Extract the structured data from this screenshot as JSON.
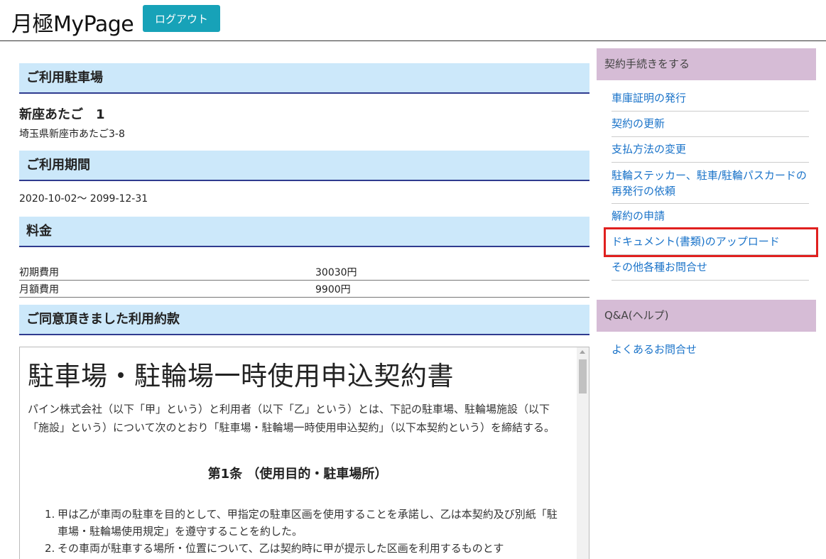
{
  "header": {
    "app_title": "月極MyPage",
    "logout_label": "ログアウト"
  },
  "main": {
    "parking": {
      "heading": "ご利用駐車場",
      "name": "新座あたご　1",
      "address": "埼玉県新座市あたご3-8"
    },
    "period": {
      "heading": "ご利用期間",
      "value": "2020-10-02〜 2099-12-31"
    },
    "fees": {
      "heading": "料金",
      "rows": [
        {
          "label": "初期費用",
          "value": "30030円"
        },
        {
          "label": "月額費用",
          "value": "9900円"
        }
      ]
    },
    "terms": {
      "heading": "ご同意頂きました利用約款",
      "title": "駐車場・駐輪場一時使用申込契約書",
      "intro": "パイン株式会社（以下「甲」という）と利用者（以下「乙」という）とは、下記の駐車場、駐輪場施設（以下「施設」という）について次のとおり「駐車場・駐輪場一時使用申込契約」（以下本契約という）を締結する。",
      "article_title": "第1条 （使用目的・駐車場所）",
      "items": [
        {
          "num": "1.",
          "text": "甲は乙が車両の駐車を目的として、甲指定の駐車区画を使用することを承諾し、乙は本契約及び別紙「駐車場・駐輪場使用規定」を遵守することを約した。"
        },
        {
          "num": "2.",
          "text": "その車両が駐車する場所・位置について、乙は契約時に甲が提示した区画を利用するものとす"
        }
      ]
    }
  },
  "sidebar": {
    "contract": {
      "heading": "契約手続きをする",
      "links": [
        "車庫証明の発行",
        "契約の更新",
        "支払方法の変更",
        "駐輪ステッカー、駐車/駐輪パスカードの再発行の依頼",
        "解約の申請",
        "ドキュメント(書類)のアップロード",
        "その他各種お問合せ"
      ]
    },
    "help": {
      "heading": "Q&A(ヘルプ)",
      "links": [
        "よくあるお問合せ"
      ]
    }
  },
  "colors": {
    "accent_button": "#17a2b8",
    "section_bg": "#cce8fa",
    "section_border": "#2f3b8f",
    "sidebar_head_bg": "#d6bcd6",
    "link": "#1a73c9",
    "highlight": "#e0201f"
  }
}
